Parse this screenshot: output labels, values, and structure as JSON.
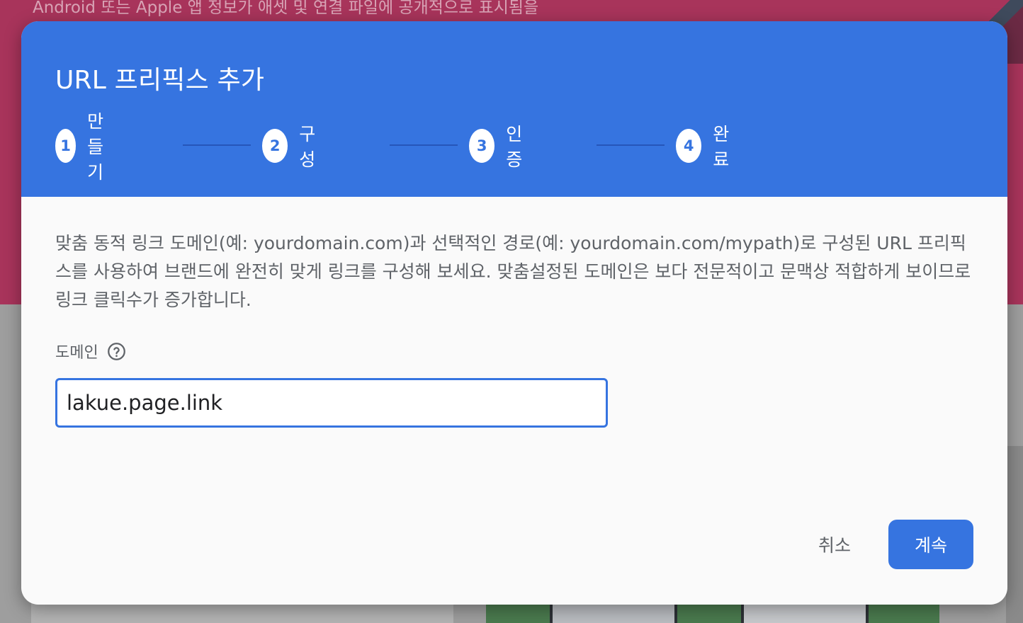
{
  "background": {
    "top_text": "Android 또는 Apple 앱 정보가 애셋 및 연결 파일에 공개적으로 표시됨을",
    "colors": {
      "top": "#a8345b",
      "bottom": "#9e9e9e"
    }
  },
  "modal": {
    "title": "URL 프리픽스 추가",
    "steps": [
      {
        "number": "1",
        "label": "만들기"
      },
      {
        "number": "2",
        "label": "구성"
      },
      {
        "number": "3",
        "label": "인증"
      },
      {
        "number": "4",
        "label": "완료"
      }
    ],
    "description": "맞춤 동적 링크 도메인(예: yourdomain.com)과 선택적인 경로(예: yourdomain.com/mypath)로 구성된 URL 프리픽스를 사용하여 브랜드에 완전히 맞게 링크를 구성해 보세요. 맞춤설정된 도메인은 보다 전문적이고 문맥상 적합하게 보이므로 링크 클릭수가 증가합니다.",
    "domain_field": {
      "label": "도메인",
      "help_icon": "help-circle-icon",
      "value": "lakue.page.link"
    },
    "actions": {
      "cancel_label": "취소",
      "continue_label": "계속"
    },
    "colors": {
      "accent": "#3674e0",
      "text_secondary": "#5f6368"
    }
  }
}
